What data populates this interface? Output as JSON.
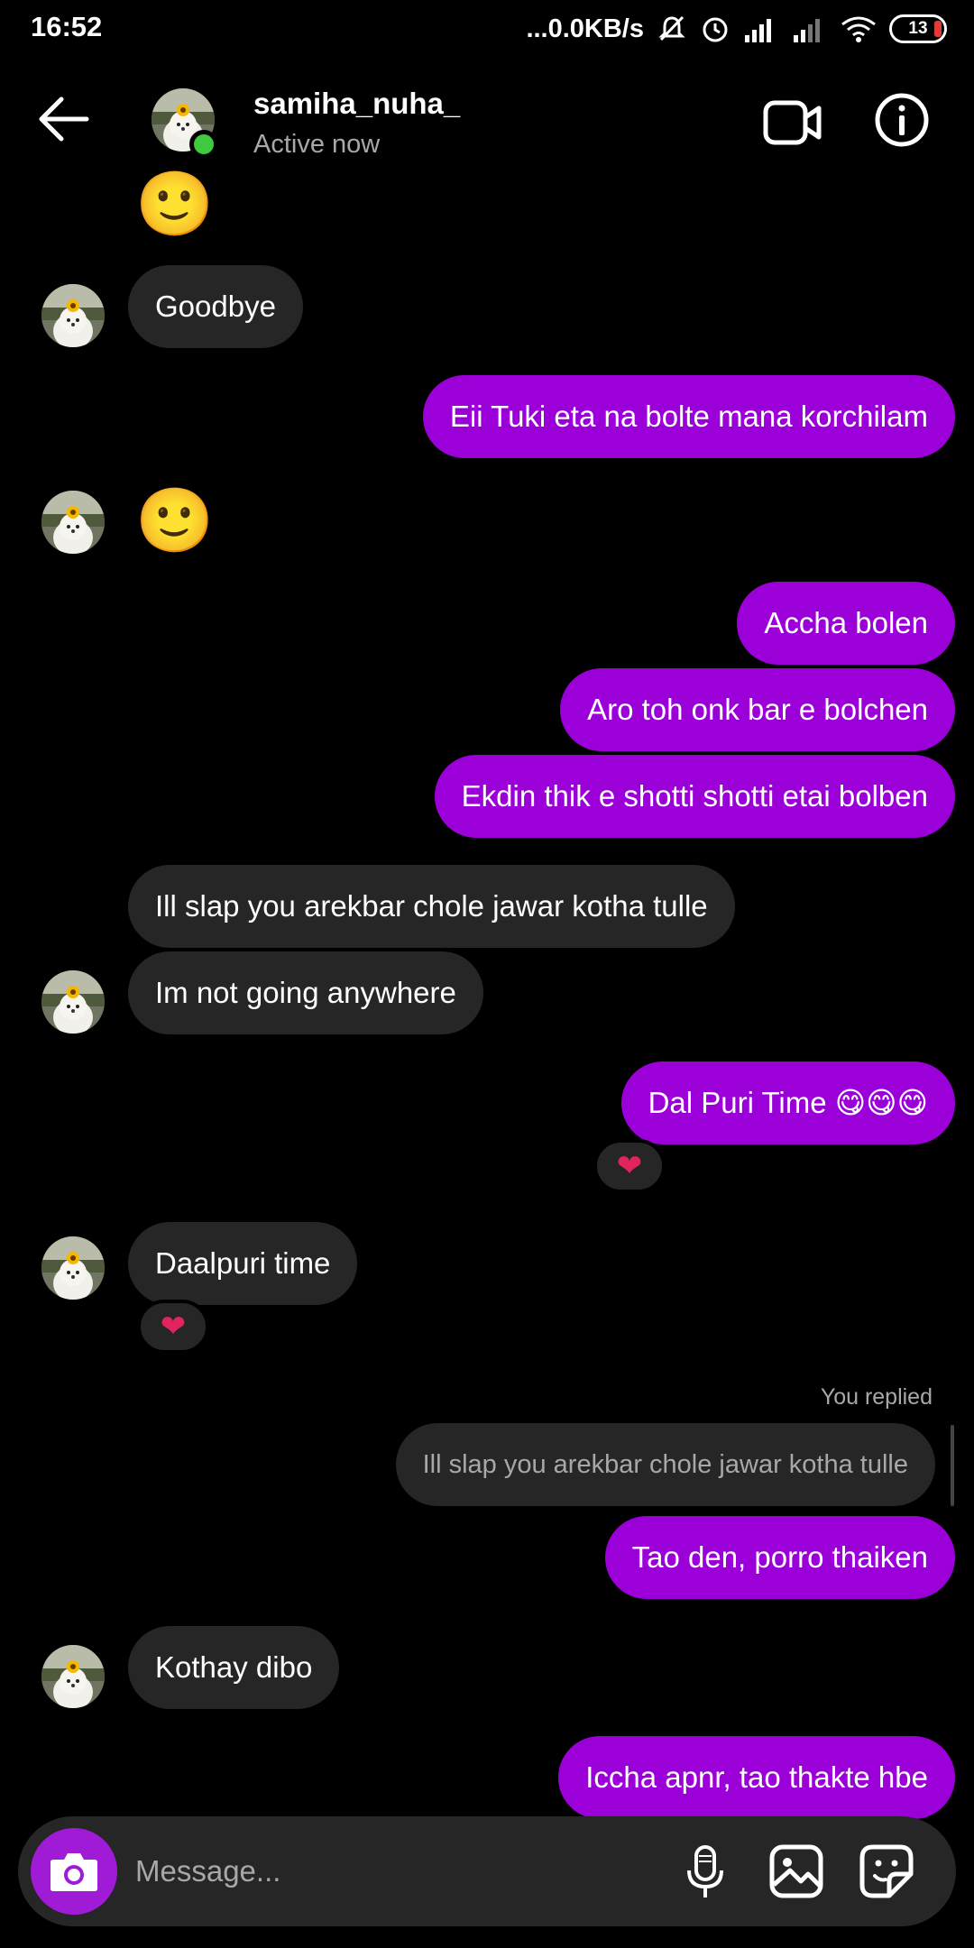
{
  "status_bar": {
    "time": "16:52",
    "network_speed": "...0.0KB/s",
    "battery": "13",
    "icons": [
      "mute-icon",
      "alarm-icon",
      "signal-icon",
      "signal-icon",
      "wifi-icon",
      "battery-icon"
    ]
  },
  "header": {
    "contact_name": "samiha_nuha_",
    "contact_status": "Active now",
    "icons": [
      "back-arrow-icon",
      "video-call-icon",
      "info-icon"
    ]
  },
  "messages": [
    {
      "dir": "in",
      "text": "🙂",
      "type": "emoji"
    },
    {
      "dir": "in",
      "text": "Goodbye"
    },
    {
      "dir": "out",
      "text": "Eii Tuki eta na bolte mana korchilam"
    },
    {
      "dir": "in",
      "text": "🙂",
      "type": "emoji"
    },
    {
      "dir": "out",
      "text": "Accha bolen"
    },
    {
      "dir": "out",
      "text": "Aro toh onk bar e bolchen"
    },
    {
      "dir": "out",
      "text": "Ekdin thik e shotti shotti etai bolben"
    },
    {
      "dir": "in",
      "text": "Ill slap you arekbar chole jawar kotha tulle"
    },
    {
      "dir": "in",
      "text": "Im not going anywhere"
    },
    {
      "dir": "out",
      "text": "Dal Puri Time 😋😋😋",
      "reaction": "❤"
    },
    {
      "dir": "in",
      "text": "Daalpuri time",
      "reaction": "❤"
    },
    {
      "dir": "out",
      "text": "Tao den, porro thaiken",
      "replied_label": "You replied",
      "quoted": "Ill slap you arekbar chole jawar kotha tulle"
    },
    {
      "dir": "in",
      "text": "Kothay dibo"
    },
    {
      "dir": "out",
      "text": "Iccha apnr, tao thakte hbe"
    }
  ],
  "composer": {
    "placeholder": "Message...",
    "icons": [
      "camera-icon",
      "microphone-icon",
      "gallery-icon",
      "sticker-icon"
    ]
  },
  "colors": {
    "background": "#000000",
    "incoming_bubble": "#262626",
    "outgoing_bubble": "#9c00d9",
    "camera_button": "#a01bd6",
    "online_dot": "#3ec93e"
  }
}
